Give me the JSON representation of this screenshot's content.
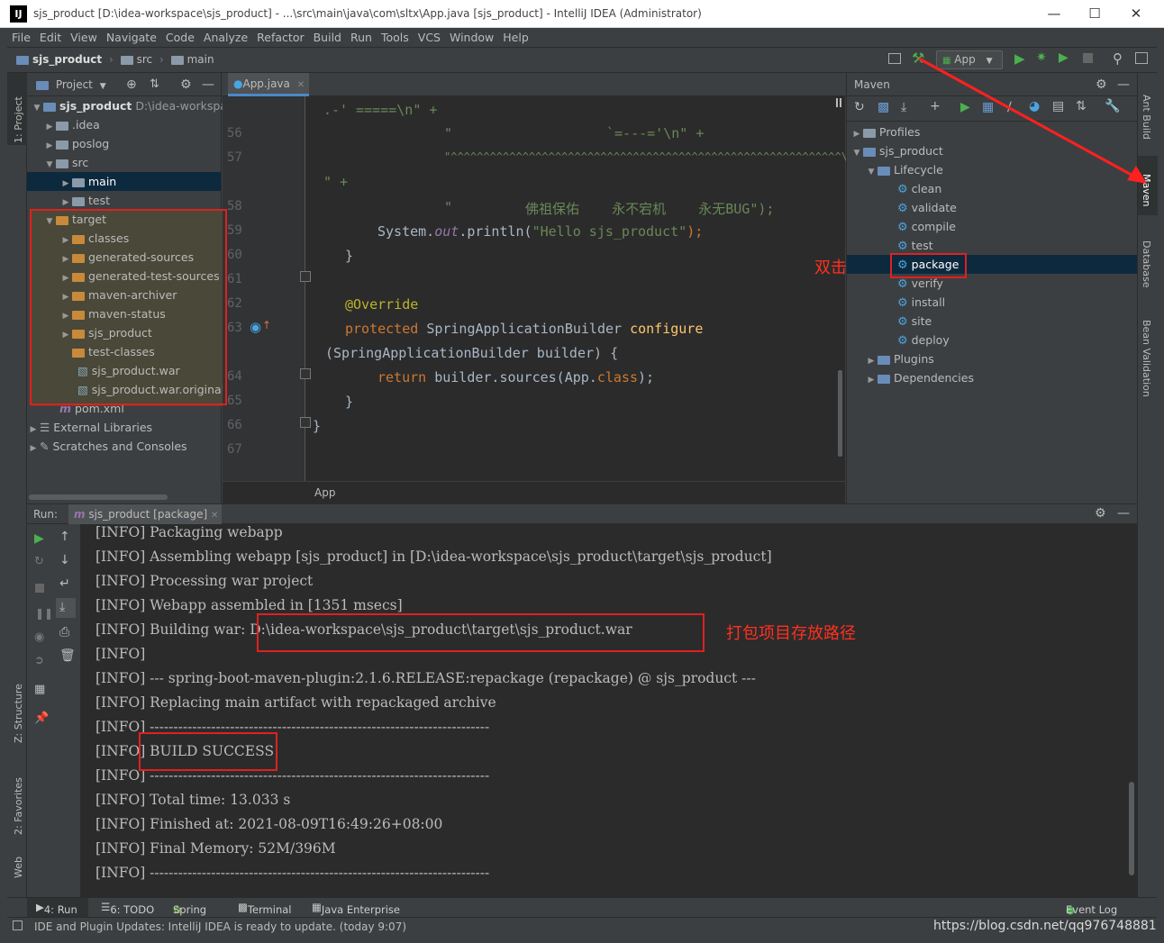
{
  "window": {
    "title": "sjs_product [D:\\idea-workspace\\sjs_product] - ...\\src\\main\\java\\com\\sltx\\App.java [sjs_product] - IntelliJ IDEA (Administrator)",
    "logo": "IJ"
  },
  "menu": [
    "File",
    "Edit",
    "View",
    "Navigate",
    "Code",
    "Analyze",
    "Refactor",
    "Build",
    "Run",
    "Tools",
    "VCS",
    "Window",
    "Help"
  ],
  "breadcrumb": [
    "sjs_product",
    "src",
    "main"
  ],
  "run_config": "App",
  "left_strip": {
    "project": "1: Project",
    "structure": "Z: Structure",
    "favorites": "2: Favorites",
    "web": "Web"
  },
  "right_strip": {
    "ant": "Ant Build",
    "maven": "Maven",
    "database": "Database",
    "bean": "Bean Validation"
  },
  "project": {
    "header": "Project",
    "root": {
      "name": "sjs_product",
      "path": "D:\\idea-workspace\\sjs_product"
    },
    "items": [
      ".idea",
      "poslog",
      "src",
      "main",
      "test",
      "target",
      "classes",
      "generated-sources",
      "generated-test-sources",
      "maven-archiver",
      "maven-status",
      "sjs_product",
      "test-classes",
      "sjs_product.war",
      "sjs_product.war.original",
      "pom.xml",
      "External Libraries",
      "Scratches and Consoles"
    ]
  },
  "editor": {
    "tab": "App.java",
    "status": "App",
    "line_numbers": [
      "56",
      "57",
      "58",
      "59",
      "60",
      "61",
      "62",
      "63",
      "64",
      "65",
      "66",
      "67"
    ],
    "lines": {
      "l1": ".-' =====\\n\" +",
      "l2a": "\"",
      "l2b": "`=---='\\n\" +",
      "l3": "\"^^^^^^^^^^^^^^^^^^^^^^^^^^^^^^^^^^^^^^^^^^^^^^^^^^^^^^^^^^^^\\n",
      "l4": "\" +",
      "l5a": "\"",
      "l5b": "佛祖保佑    永不宕机    永无BUG\");",
      "l6a": "System.",
      "l6b": "out",
      "l6c": ".println(",
      "l6d": "\"Hello sjs_product\"",
      "l6e": ");",
      "l7": "}",
      "l8": "@Override",
      "l9a": "protected ",
      "l9b": "SpringApplicationBuilder ",
      "l9c": "configure",
      "l10": "(SpringApplicationBuilder builder) {",
      "l11a": "return ",
      "l11b": "builder.sources(App.",
      "l11c": "class",
      "l11d": ");",
      "l12": "}",
      "l13": "}"
    }
  },
  "maven": {
    "header": "Maven",
    "profiles": "Profiles",
    "project": "sjs_product",
    "lifecycle": "Lifecycle",
    "goals": [
      "clean",
      "validate",
      "compile",
      "test",
      "package",
      "verify",
      "install",
      "site",
      "deploy"
    ],
    "plugins": "Plugins",
    "dependencies": "Dependencies"
  },
  "run": {
    "label": "Run:",
    "tab": "sjs_product [package]",
    "log": [
      "[INFO] Packaging webapp",
      "[INFO] Assembling webapp [sjs_product] in [D:\\idea-workspace\\sjs_product\\target\\sjs_product]",
      "[INFO] Processing war project",
      "[INFO] Webapp assembled in [1351 msecs]",
      "[INFO] Building war: D:\\idea-workspace\\sjs_product\\target\\sjs_product.war",
      "[INFO]",
      "[INFO] --- spring-boot-maven-plugin:2.1.6.RELEASE:repackage (repackage) @ sjs_product ---",
      "[INFO] Replacing main artifact with repackaged archive",
      "[INFO] ------------------------------------------------------------------------",
      "[INFO] BUILD SUCCESS",
      "[INFO] ------------------------------------------------------------------------",
      "[INFO] Total time: 13.033 s",
      "[INFO] Finished at: 2021-08-09T16:49:26+08:00",
      "[INFO] Final Memory: 52M/396M",
      "[INFO] ------------------------------------------------------------------------"
    ]
  },
  "annotations": {
    "double_click": "双击",
    "path_note": "打包项目存放路径"
  },
  "bottom_tabs": [
    "4: Run",
    "6: TODO",
    "Spring",
    "Terminal",
    "Java Enterprise"
  ],
  "event_log": "Event Log",
  "status": "IDE and Plugin Updates: IntelliJ IDEA is ready to update. (today 9:07)",
  "watermark": "https://blog.csdn.net/qq976748881"
}
